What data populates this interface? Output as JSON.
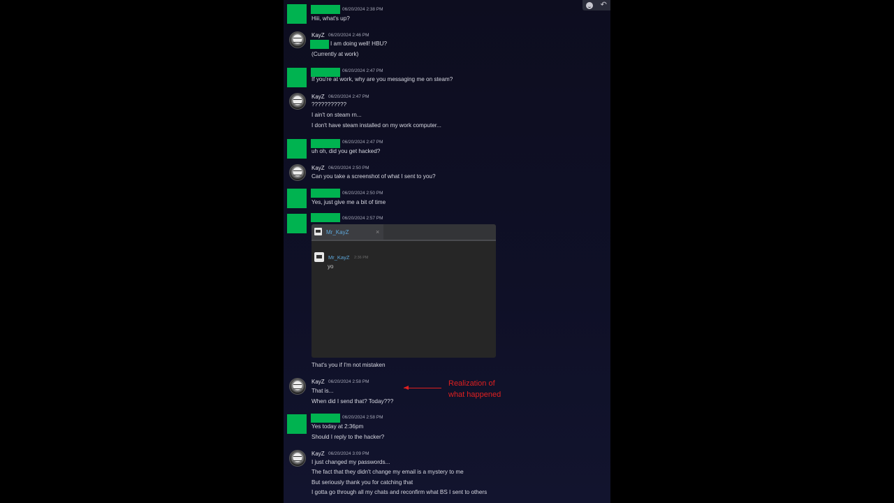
{
  "colors": {
    "redaction": "#00b350",
    "annotation": "#e02020",
    "link_blue": "#5ea9dd",
    "background": "#0f1027"
  },
  "toolbar": {
    "emoji_icon": "smiley-icon",
    "reply_icon": "reply-arrow-icon",
    "reply_glyph": "↶"
  },
  "messages": [
    {
      "sender": "redacted",
      "time": "06/20/2024 2:38 PM",
      "lines": [
        "Hiii, what's up?"
      ]
    },
    {
      "sender": "KayZ",
      "time": "06/20/2024 2:46 PM",
      "lines": [
        "I am doing well! HBU?",
        "(Currently at work)"
      ]
    },
    {
      "sender": "redacted",
      "time": "06/20/2024 2:47 PM",
      "lines": [
        "If you're at work, why are you messaging me on steam?"
      ]
    },
    {
      "sender": "KayZ",
      "time": "06/20/2024 2:47 PM",
      "lines": [
        "???????????",
        "I ain't on steam rn...",
        "I don't have steam installed on my work computer..."
      ]
    },
    {
      "sender": "redacted",
      "time": "06/20/2024 2:47 PM",
      "lines": [
        "uh oh, did you get hacked?"
      ]
    },
    {
      "sender": "KayZ",
      "time": "06/20/2024 2:50 PM",
      "lines": [
        "Can you take a screenshot of what I sent to you?"
      ]
    },
    {
      "sender": "redacted",
      "time": "06/20/2024 2:50 PM",
      "lines": [
        "Yes, just give me a bit of time"
      ]
    },
    {
      "sender": "redacted",
      "time": "06/20/2024 2:57 PM",
      "lines": [
        "That's you if I'm not mistaken"
      ]
    },
    {
      "sender": "KayZ",
      "time": "06/20/2024 2:58 PM",
      "lines": [
        "That is...",
        "When did I send that? Today???"
      ]
    },
    {
      "sender": "redacted",
      "time": "06/20/2024 2:58 PM",
      "lines": [
        "Yes today at 2:36pm",
        "Should I reply to the hacker?"
      ]
    },
    {
      "sender": "KayZ",
      "time": "06/20/2024 3:09 PM",
      "lines": [
        "I just changed my passwords...",
        "The fact that they didn't change my email is a mystery to me",
        "But seriously thank you for catching that",
        "I gotta go through all my chats and reconfirm what BS I sent to others"
      ]
    }
  ],
  "screenshot": {
    "tab_label": "Mr_KayZ",
    "close_glyph": "×",
    "sender": "Mr_KayZ",
    "time": "2:36 PM",
    "message": "yo"
  },
  "annotation": {
    "line1": "Realization  of",
    "line2": "what happened"
  }
}
